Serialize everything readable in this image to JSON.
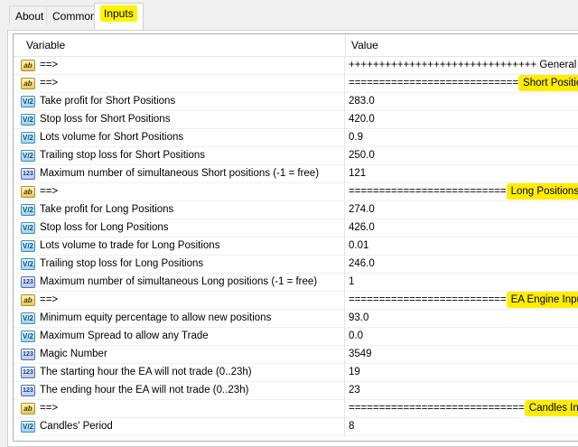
{
  "tabs": [
    {
      "label": "About"
    },
    {
      "label": "Common"
    },
    {
      "label": "Inputs"
    }
  ],
  "grid": {
    "columns": {
      "variable": "Variable",
      "value": "Value"
    },
    "rows": [
      {
        "icon": "ab",
        "name": "==>",
        "value_pre": "+++++++++++++++++++++++++++++++ General Inputs",
        "value_mark": ""
      },
      {
        "icon": "ab",
        "name": "==>",
        "value_pre": "============================",
        "value_mark": "Short Positions Inpu"
      },
      {
        "icon": "va",
        "name": "Take profit for Short Positions",
        "value_pre": "283.0",
        "value_mark": ""
      },
      {
        "icon": "va",
        "name": "Stop loss for Short Positions",
        "value_pre": "420.0",
        "value_mark": ""
      },
      {
        "icon": "va",
        "name": "Lots volume for Short Positions",
        "value_pre": "0.9",
        "value_mark": ""
      },
      {
        "icon": "va",
        "name": "Trailing stop loss for Short Positions",
        "value_pre": "250.0",
        "value_mark": ""
      },
      {
        "icon": "123",
        "name": "Maximum number of simultaneous Short positions (-1 = free)",
        "value_pre": "121",
        "value_mark": ""
      },
      {
        "icon": "ab",
        "name": "==>",
        "value_pre": "==========================",
        "value_mark": "Long Positions Inpu"
      },
      {
        "icon": "va",
        "name": "Take profit for Long Positions",
        "value_pre": "274.0",
        "value_mark": ""
      },
      {
        "icon": "va",
        "name": "Stop loss for Long Positions",
        "value_pre": "426.0",
        "value_mark": ""
      },
      {
        "icon": "va",
        "name": "Lots volume to trade for Long Positions",
        "value_pre": "0.01",
        "value_mark": ""
      },
      {
        "icon": "va",
        "name": "Trailing stop loss for Long Positions",
        "value_pre": "246.0",
        "value_mark": ""
      },
      {
        "icon": "123",
        "name": "Maximum number of simultaneous Long positions (-1 = free)",
        "value_pre": "1",
        "value_mark": ""
      },
      {
        "icon": "ab",
        "name": "==>",
        "value_pre": "==========================",
        "value_mark": "EA Engine Inputs ="
      },
      {
        "icon": "va",
        "name": "Minimum equity percentage to allow new positions",
        "value_pre": "93.0",
        "value_mark": ""
      },
      {
        "icon": "va",
        "name": "Maximum Spread to allow any Trade",
        "value_pre": "0.0",
        "value_mark": ""
      },
      {
        "icon": "123",
        "name": "Magic Number",
        "value_pre": "3549",
        "value_mark": ""
      },
      {
        "icon": "123",
        "name": "The starting hour the EA will not trade (0..23h)",
        "value_pre": "19",
        "value_mark": ""
      },
      {
        "icon": "123",
        "name": "The ending hour the EA will not trade (0..23h)",
        "value_pre": "23",
        "value_mark": ""
      },
      {
        "icon": "ab",
        "name": "==>",
        "value_pre": "=============================",
        "value_mark": "Candles Indicator"
      },
      {
        "icon": "va",
        "name": "Candles' Period",
        "value_pre": "8",
        "value_mark": ""
      }
    ]
  },
  "icons": {
    "ab": "ab",
    "va": "V/2",
    "123": "123"
  },
  "colors": {
    "highlight": "#ffed00"
  }
}
